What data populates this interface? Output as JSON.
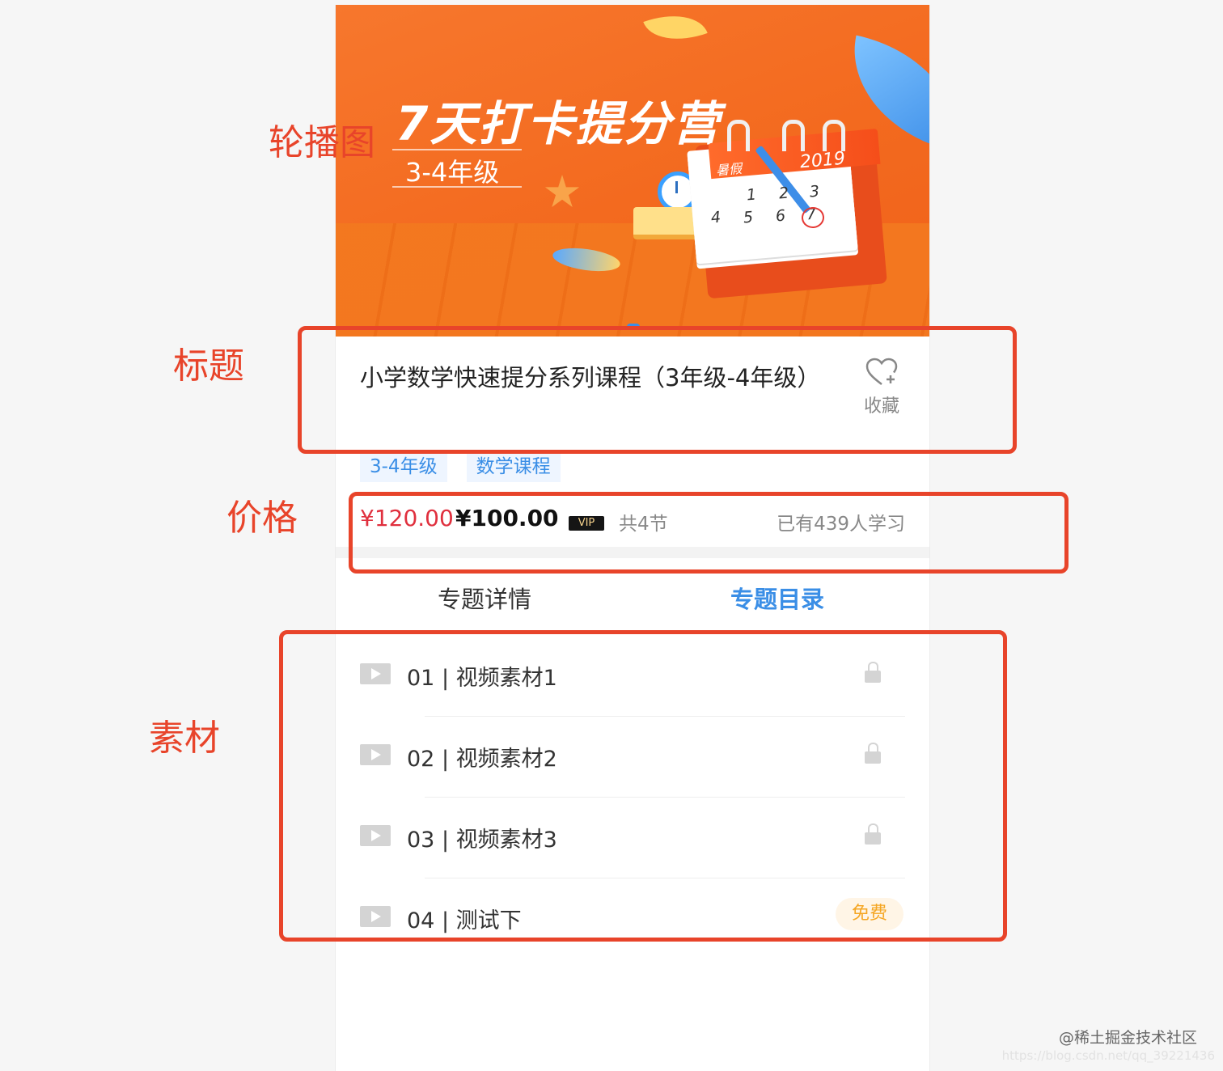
{
  "banner": {
    "title": "7天打卡提分营",
    "subtitle": "3-4年级",
    "calendar_label": "暑假",
    "calendar_year": "2019",
    "calendar_days": [
      "1",
      "2",
      "3",
      "4",
      "5",
      "6",
      "7"
    ]
  },
  "course": {
    "title": "小学数学快速提分系列课程（3年级-4年级）",
    "favorite_label": "收藏",
    "tags": [
      "3-4年级",
      "数学课程"
    ]
  },
  "price": {
    "original": "¥120.00",
    "vip": "¥100.00",
    "vip_badge": "VIP",
    "lessons": "共4节",
    "learners": "已有439人学习"
  },
  "tabs": {
    "detail": "专题详情",
    "catalog": "专题目录"
  },
  "lessons": [
    {
      "title": "01 | 视频素材1",
      "status": "locked"
    },
    {
      "title": "02 | 视频素材2",
      "status": "locked"
    },
    {
      "title": "03 | 视频素材3",
      "status": "locked"
    },
    {
      "title": "04 | 测试下",
      "status": "free",
      "badge": "免费"
    }
  ],
  "annotations": {
    "carousel": "轮播图",
    "title": "标题",
    "price": "价格",
    "materials": "素材"
  },
  "watermark": "@稀土掘金技术社区",
  "watermark_url": "https://blog.csdn.net/qq_39221436",
  "colors": {
    "accent_blue": "#3a8ee6",
    "price_red": "#e0303e",
    "annotation_red": "#e8442a",
    "free_orange": "#f5a623"
  }
}
